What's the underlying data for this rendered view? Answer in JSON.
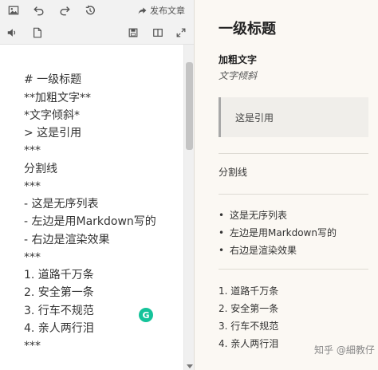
{
  "toolbar": {
    "row1_icons": [
      "image-icon",
      "undo-icon",
      "redo-icon",
      "history-icon"
    ],
    "row2_icons": [
      "speaker-icon",
      "file-icon"
    ],
    "right_icons": [
      "save-icon",
      "split-view-icon",
      "fullscreen-icon"
    ],
    "publish_label": "发布文章"
  },
  "editor": {
    "lines": [
      "# 一级标题",
      "**加粗文字**",
      "*文字倾斜*",
      "> 这是引用",
      "***",
      "分割线",
      "***",
      "- 这是无序列表",
      "- 左边是用Markdown写的",
      "- 右边是渲染效果",
      "***",
      "1. 道路千万条",
      "2. 安全第一条",
      "3. 行车不规范",
      "4. 亲人两行泪",
      "***"
    ]
  },
  "preview": {
    "heading": "一级标题",
    "bold": "加粗文字",
    "italic": "文字倾斜",
    "quote": "这是引用",
    "divider_text": "分割线",
    "bullets": [
      "这是无序列表",
      "左边是用Markdown写的",
      "右边是渲染效果"
    ],
    "ordered": [
      "1. 道路千万条",
      "2. 安全第一条",
      "3. 行车不规范",
      "4. 亲人两行泪"
    ]
  },
  "watermark": "知乎 @細教仔",
  "grammarly_label": "G",
  "colors": {
    "toolbar_bg": "#f2f2f2",
    "preview_bg": "#fbf8f3",
    "grammarly": "#15c39a",
    "quote_border": "#a8a8a8"
  }
}
